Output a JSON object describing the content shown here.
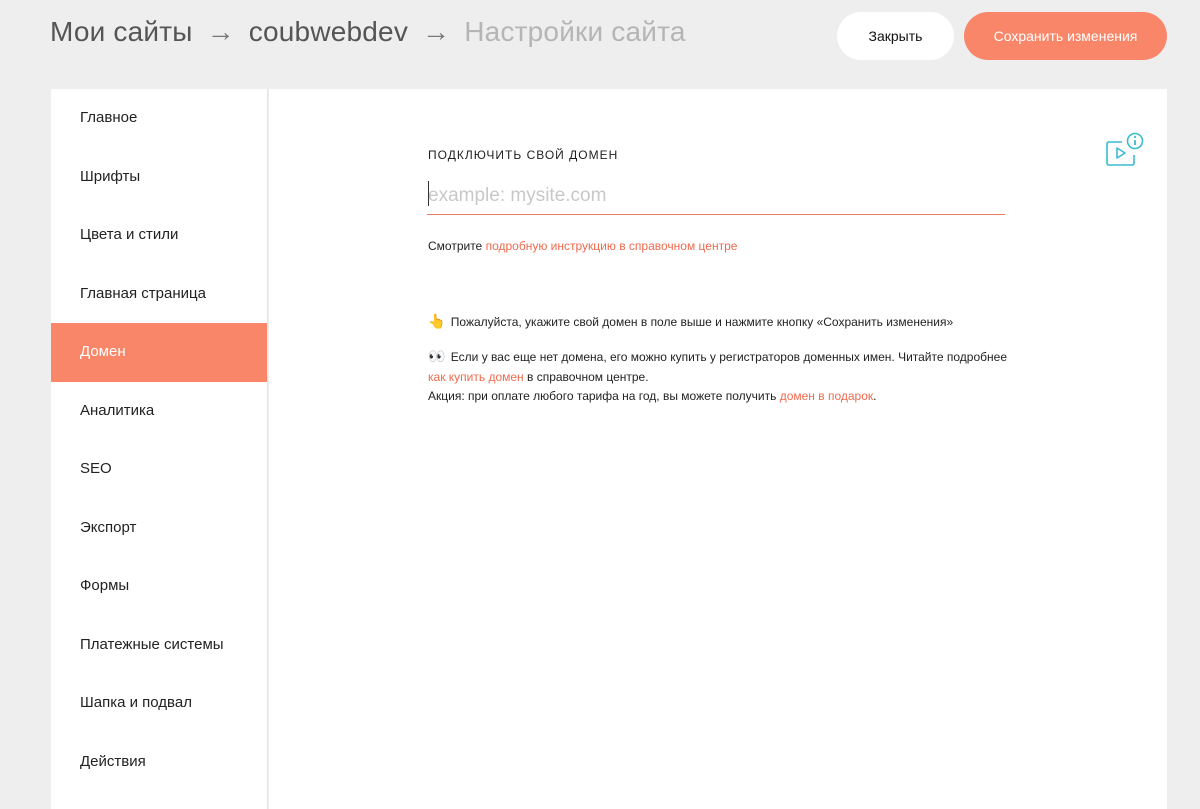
{
  "header": {
    "breadcrumb": [
      "Мои сайты",
      "coubwebdev",
      "Настройки сайта"
    ],
    "arrow": "→",
    "close_label": "Закрыть",
    "save_label": "Сохранить изменения"
  },
  "sidebar": {
    "items": [
      {
        "label": "Главное"
      },
      {
        "label": "Шрифты"
      },
      {
        "label": "Цвета и стили"
      },
      {
        "label": "Главная страница"
      },
      {
        "label": "Домен",
        "active": true
      },
      {
        "label": "Аналитика"
      },
      {
        "label": "SEO"
      },
      {
        "label": "Экспорт"
      },
      {
        "label": "Формы"
      },
      {
        "label": "Платежные системы"
      },
      {
        "label": "Шапка и подвал"
      },
      {
        "label": "Действия"
      }
    ]
  },
  "main": {
    "section_title": "ПОДКЛЮЧИТЬ СВОЙ ДОМЕН",
    "domain_input": {
      "value": "",
      "placeholder": "example: mysite.com"
    },
    "hint_prefix": "Смотрите ",
    "hint_link": "подробную инструкцию в справочном центре",
    "note1_emoji": "👆",
    "note1_text": "Пожалуйста, укажите свой домен в поле выше и нажмите кнопку «Сохранить изменения»",
    "note2_emoji": "👀",
    "note2_text1": "Если у вас еще нет домена, его можно купить у регистраторов доменных имен. Читайте подробнее",
    "note2_link1": "как купить домен",
    "note2_text2": " в справочном центре.",
    "note2_text3": "Акция: при оплате любого тарифа на год, вы можете получить ",
    "note2_link2": "домен в подарок",
    "note2_text4": "."
  },
  "icons": {
    "help_video": "video-info-icon"
  },
  "colors": {
    "accent": "#fa8669",
    "link": "#f06a4d",
    "icon": "#3bbbd0"
  }
}
